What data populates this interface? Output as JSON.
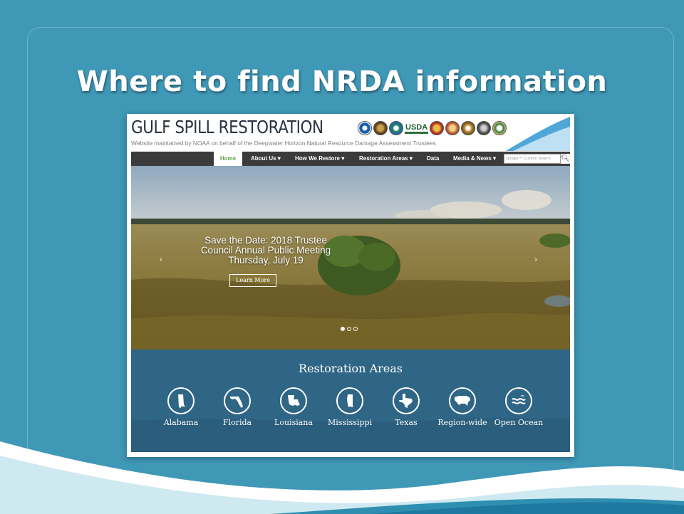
{
  "slide": {
    "title": "Where to find NRDA information"
  },
  "site": {
    "name": "GULF SPILL RESTORATION",
    "subtitle": "Website maintained by NOAA on behalf of the Deepwater Horizon Natural Resource Damage Assessment Trustees",
    "usda": "USDA"
  },
  "nav": {
    "items": [
      "Home",
      "About Us ▾",
      "How We Restore ▾",
      "Restoration Areas ▾",
      "Data",
      "Media & News ▾"
    ],
    "search_placeholder": "Google™ Custom Search"
  },
  "hero": {
    "line1": "Save the Date: 2018 Trustee",
    "line2": "Council Annual Public Meeting",
    "line3": "Thursday, July 19",
    "button": "Learn More",
    "prev": "‹",
    "next": "›"
  },
  "areas": {
    "title": "Restoration Areas",
    "items": [
      {
        "label": "Alabama",
        "icon": "alabama-icon"
      },
      {
        "label": "Florida",
        "icon": "florida-icon"
      },
      {
        "label": "Louisiana",
        "icon": "louisiana-icon"
      },
      {
        "label": "Mississippi",
        "icon": "mississippi-icon"
      },
      {
        "label": "Texas",
        "icon": "texas-icon"
      },
      {
        "label": "Region-wide",
        "icon": "us-map-icon"
      },
      {
        "label": "Open Ocean",
        "icon": "ocean-waves-icon"
      }
    ]
  },
  "colors": {
    "slide_bg": "#3f98b6",
    "nav_bg": "#3b3b3b",
    "areas_bg": "#2f6585",
    "home_accent": "#6aa84f"
  }
}
